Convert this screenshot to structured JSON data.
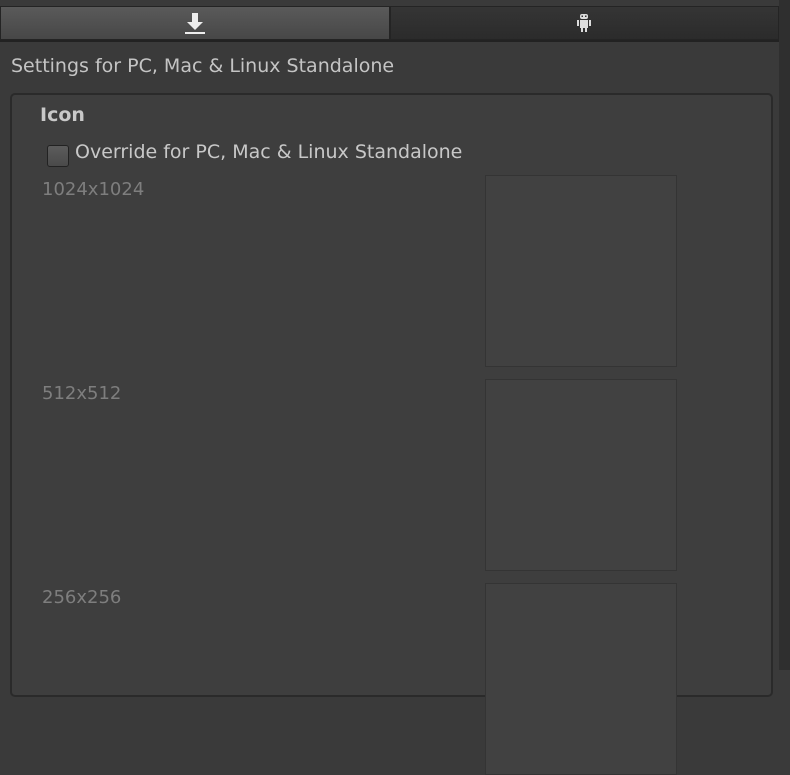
{
  "tabs": [
    {
      "icon": "download-icon",
      "active": true
    },
    {
      "icon": "android-icon",
      "active": false
    }
  ],
  "settings_title": "Settings for PC, Mac & Linux Standalone",
  "icon_section": {
    "heading": "Icon",
    "override_label": "Override for PC, Mac & Linux Standalone",
    "override_checked": false,
    "sizes": [
      {
        "label": "1024x1024"
      },
      {
        "label": "512x512"
      },
      {
        "label": "256x256"
      }
    ]
  }
}
